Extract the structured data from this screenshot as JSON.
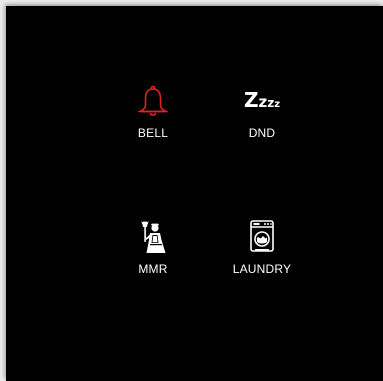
{
  "colors": {
    "background": "#000000",
    "label": "#ffffff",
    "bell_accent": "#e02424"
  },
  "tiles": [
    {
      "label": "BELL",
      "icon": "bell-icon",
      "color": "#e02424"
    },
    {
      "label": "DND",
      "icon": "sleep-zzz-icon",
      "color": "#ffffff"
    },
    {
      "label": "MMR",
      "icon": "maid-icon",
      "color": "#ffffff"
    },
    {
      "label": "LAUNDRY",
      "icon": "washing-machine-icon",
      "color": "#ffffff"
    }
  ],
  "dnd_glyph": {
    "z1": "Z",
    "z2": "z",
    "z3": "z",
    "z4": "z"
  }
}
